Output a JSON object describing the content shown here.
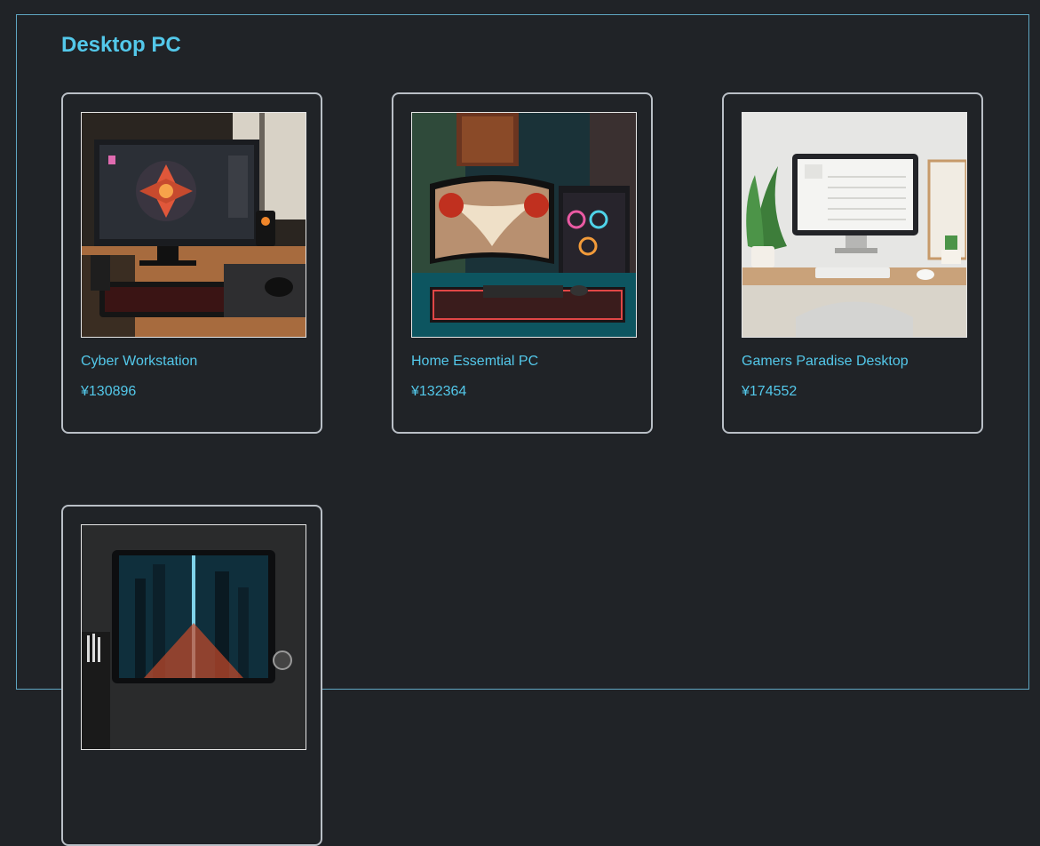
{
  "section": {
    "title": "Desktop PC"
  },
  "products": [
    {
      "name": "Cyber Workstation",
      "price": "¥130896",
      "image": "cyber-workstation-photo"
    },
    {
      "name": "Home Essemtial PC",
      "price": "¥132364",
      "image": "home-essential-pc-photo"
    },
    {
      "name": "Gamers Paradise Desktop",
      "price": "¥174552",
      "image": "gamers-paradise-photo"
    },
    {
      "name": "",
      "price": "",
      "image": "futuristic-city-desktop-photo"
    }
  ],
  "colors": {
    "accent": "#53c8ea",
    "background": "#202327",
    "card_border": "#b9bfc6",
    "frame_border": "#5fa6c2"
  }
}
